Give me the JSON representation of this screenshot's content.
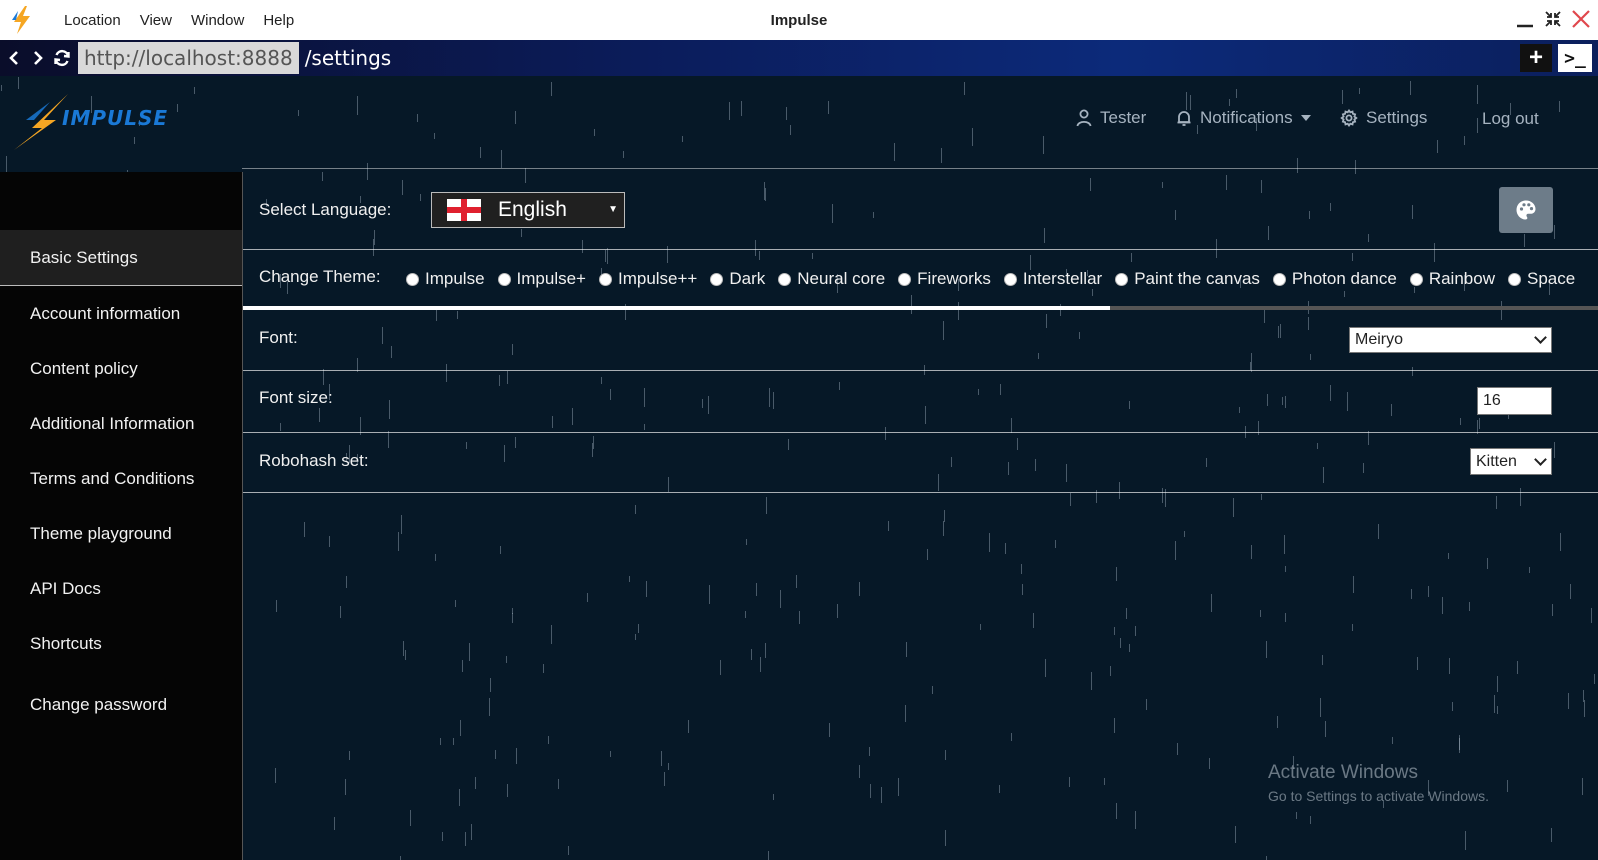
{
  "window": {
    "title": "Impulse",
    "menu": [
      "Location",
      "View",
      "Window",
      "Help"
    ]
  },
  "address": {
    "host": "http://localhost:8888",
    "path": "/settings"
  },
  "header": {
    "brand": "IMPULSE",
    "nav": {
      "user": "Tester",
      "notifications": "Notifications",
      "settings": "Settings",
      "logout": "Log out"
    }
  },
  "sidebar": {
    "items": [
      "Basic Settings",
      "Account information",
      "Content policy",
      "Additional Information",
      "Terms and Conditions",
      "Theme playground",
      "API Docs",
      "Shortcuts",
      "Change password"
    ],
    "active": "Basic Settings"
  },
  "settings": {
    "language": {
      "label": "Select Language:",
      "value": "English"
    },
    "theme": {
      "label": "Change Theme:",
      "options": [
        "Impulse",
        "Impulse+",
        "Impulse++",
        "Dark",
        "Neural core",
        "Fireworks",
        "Interstellar",
        "Paint the canvas",
        "Photon dance",
        "Rainbow",
        "Space"
      ],
      "scroll_fraction": 0.64
    },
    "font": {
      "label": "Font:",
      "value": "Meiryo"
    },
    "font_size": {
      "label": "Font size:",
      "value": "16"
    },
    "robohash": {
      "label": "Robohash set:",
      "value": "Kitten"
    }
  },
  "watermark": {
    "line1": "Activate Windows",
    "line2": "Go to Settings to activate Windows."
  },
  "colors": {
    "background": "#061827",
    "sidebar": "#050505",
    "brand_blue": "#1a79d6",
    "brand_orange": "#f5a623"
  }
}
